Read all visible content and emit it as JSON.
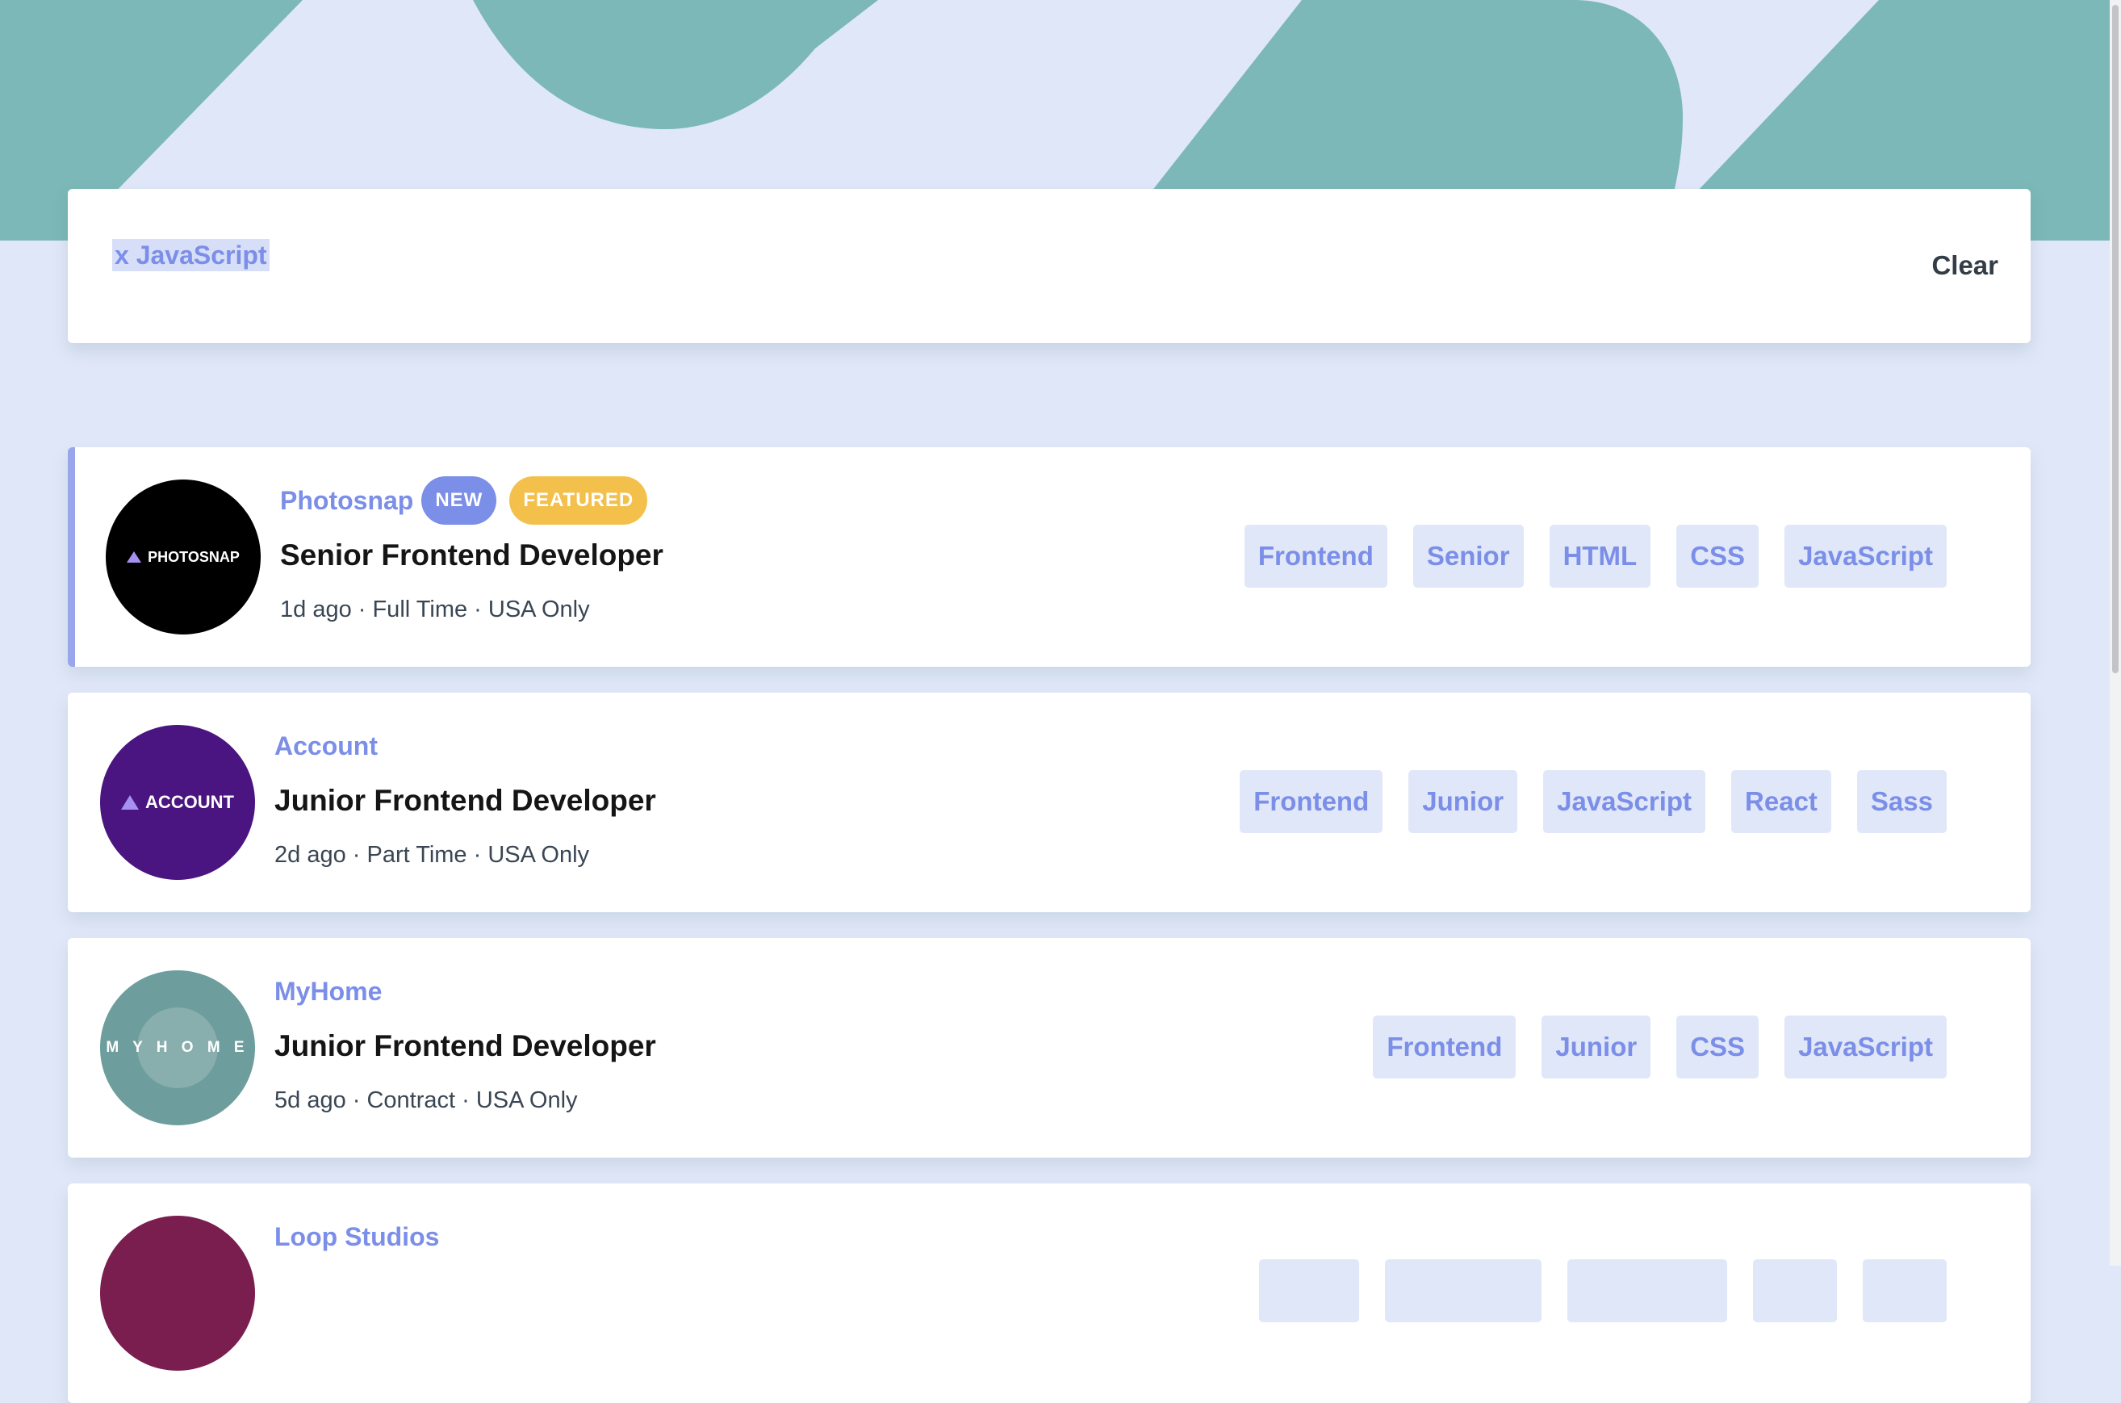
{
  "theme": {
    "accent": "#7b8ee8",
    "teal": "#7bb8b7",
    "background": "#e0e7f8",
    "badge_featured": "#f3c04c"
  },
  "filter": {
    "chips": [
      {
        "label": "x JavaScript"
      }
    ],
    "clear_label": "Clear"
  },
  "jobs": [
    {
      "company": "Photosnap",
      "logo_text": "PHOTOSNAP",
      "logo_color": "#000000",
      "new_label": "NEW",
      "featured_label": "FEATURED",
      "position": "Senior Frontend Developer",
      "meta": "1d ago · Full Time · USA Only",
      "tags": [
        "Frontend",
        "Senior",
        "HTML",
        "CSS",
        "JavaScript"
      ]
    },
    {
      "company": "Account",
      "logo_text": "ACCOUNT",
      "logo_color": "#4a1580",
      "position": "Junior Frontend Developer",
      "meta": "2d ago · Part Time · USA Only",
      "tags": [
        "Frontend",
        "Junior",
        "JavaScript",
        "React",
        "Sass"
      ]
    },
    {
      "company": "MyHome",
      "logo_text": "M Y H O M E",
      "logo_color": "#6e9d9d",
      "position": "Junior Frontend Developer",
      "meta": "5d ago · Contract · USA Only",
      "tags": [
        "Frontend",
        "Junior",
        "CSS",
        "JavaScript"
      ]
    },
    {
      "company": "Loop Studios",
      "logo_color": "#7a1d4f"
    }
  ]
}
